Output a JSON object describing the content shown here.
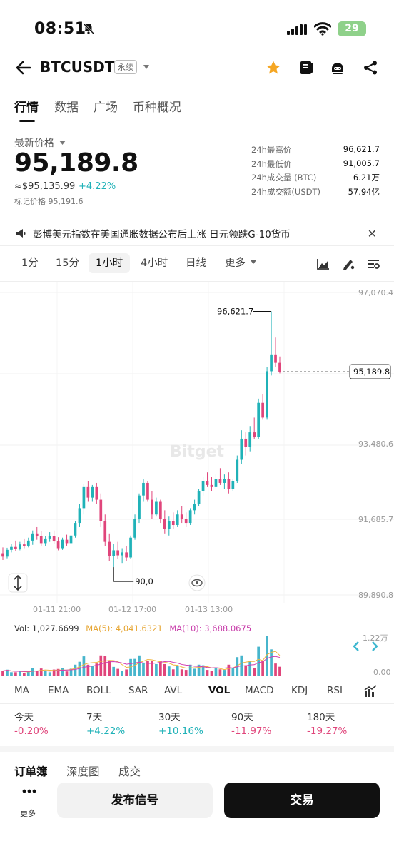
{
  "status_bar": {
    "time": "08:51",
    "battery": "29"
  },
  "header": {
    "symbol": "BTCUSDT",
    "badge": "永续"
  },
  "tabs": [
    "行情",
    "数据",
    "广场",
    "币种概况"
  ],
  "price": {
    "label": "最新价格",
    "last": "95,189.8",
    "usd": "≈$95,135.99",
    "change": "+4.22%",
    "mark": "标记价格 95,191.6"
  },
  "stats": [
    {
      "label": "24h最高价",
      "value": "96,621.7"
    },
    {
      "label": "24h最低价",
      "value": "91,005.7"
    },
    {
      "label": "24h成交量 (BTC)",
      "value": "6.21万"
    },
    {
      "label": "24h成交额(USDT)",
      "value": "57.94亿"
    }
  ],
  "news": {
    "text": "彭博美元指数在美国通胀数据公布后上涨 日元领跌G-10货币"
  },
  "timeframes": [
    "1分",
    "15分",
    "1小时",
    "4小时",
    "日线",
    "更多"
  ],
  "active_timeframe": "1小时",
  "chart_data": {
    "type": "candlestick",
    "y_ticks": [
      "97,070.4",
      "93,480.6",
      "91,685.7",
      "89,890.8"
    ],
    "x_ticks": [
      "01-11 21:00",
      "01-12 17:00",
      "01-13 13:00"
    ],
    "ylim": [
      89890.8,
      97070.4
    ],
    "current_price_tag": "95,189.8",
    "high_label": "96,621.7",
    "low_label": "90,0",
    "watermark": "Bitget",
    "candles": [
      {
        "o": 90880,
        "h": 91020,
        "l": 90720,
        "c": 90800
      },
      {
        "o": 90800,
        "h": 91010,
        "l": 90760,
        "c": 90960
      },
      {
        "o": 90960,
        "h": 91110,
        "l": 90900,
        "c": 91030
      },
      {
        "o": 91030,
        "h": 91180,
        "l": 90930,
        "c": 90980
      },
      {
        "o": 90980,
        "h": 91150,
        "l": 90950,
        "c": 91090
      },
      {
        "o": 91090,
        "h": 91230,
        "l": 91000,
        "c": 91060
      },
      {
        "o": 91060,
        "h": 91250,
        "l": 91020,
        "c": 91180
      },
      {
        "o": 91180,
        "h": 91420,
        "l": 91080,
        "c": 91350
      },
      {
        "o": 91350,
        "h": 91500,
        "l": 91200,
        "c": 91280
      },
      {
        "o": 91280,
        "h": 91400,
        "l": 91050,
        "c": 91120
      },
      {
        "o": 91120,
        "h": 91290,
        "l": 91050,
        "c": 91230
      },
      {
        "o": 91230,
        "h": 91380,
        "l": 91150,
        "c": 91290
      },
      {
        "o": 91290,
        "h": 91420,
        "l": 91100,
        "c": 91160
      },
      {
        "o": 91160,
        "h": 91260,
        "l": 90950,
        "c": 91000
      },
      {
        "o": 91000,
        "h": 91250,
        "l": 90960,
        "c": 91200
      },
      {
        "o": 91200,
        "h": 91320,
        "l": 91060,
        "c": 91120
      },
      {
        "o": 91120,
        "h": 91380,
        "l": 91090,
        "c": 91300
      },
      {
        "o": 91300,
        "h": 91650,
        "l": 91250,
        "c": 91600
      },
      {
        "o": 91600,
        "h": 92050,
        "l": 91500,
        "c": 91950
      },
      {
        "o": 91950,
        "h": 92520,
        "l": 91800,
        "c": 92450
      },
      {
        "o": 92450,
        "h": 92600,
        "l": 92100,
        "c": 92200
      },
      {
        "o": 92200,
        "h": 92500,
        "l": 92100,
        "c": 92450
      },
      {
        "o": 92450,
        "h": 92550,
        "l": 92050,
        "c": 92150
      },
      {
        "o": 92150,
        "h": 92300,
        "l": 91500,
        "c": 91650
      },
      {
        "o": 91650,
        "h": 91800,
        "l": 91050,
        "c": 91150
      },
      {
        "o": 91150,
        "h": 91350,
        "l": 90700,
        "c": 90820
      },
      {
        "o": 90820,
        "h": 91100,
        "l": 90550,
        "c": 90950
      },
      {
        "o": 90950,
        "h": 91150,
        "l": 90750,
        "c": 90830
      },
      {
        "o": 90830,
        "h": 91000,
        "l": 90650,
        "c": 90900
      },
      {
        "o": 90900,
        "h": 91050,
        "l": 90700,
        "c": 90780
      },
      {
        "o": 90780,
        "h": 91300,
        "l": 90750,
        "c": 91250
      },
      {
        "o": 91250,
        "h": 91800,
        "l": 91200,
        "c": 91700
      },
      {
        "o": 91700,
        "h": 92300,
        "l": 91600,
        "c": 92250
      },
      {
        "o": 92250,
        "h": 92650,
        "l": 92100,
        "c": 92550
      },
      {
        "o": 92550,
        "h": 92600,
        "l": 92100,
        "c": 92150
      },
      {
        "o": 92150,
        "h": 92350,
        "l": 91700,
        "c": 91800
      },
      {
        "o": 91800,
        "h": 92200,
        "l": 91750,
        "c": 92100
      },
      {
        "o": 92100,
        "h": 92150,
        "l": 91600,
        "c": 91700
      },
      {
        "o": 91700,
        "h": 91900,
        "l": 91350,
        "c": 91450
      },
      {
        "o": 91450,
        "h": 91750,
        "l": 91300,
        "c": 91650
      },
      {
        "o": 91650,
        "h": 91850,
        "l": 91450,
        "c": 91550
      },
      {
        "o": 91550,
        "h": 91900,
        "l": 91500,
        "c": 91800
      },
      {
        "o": 91800,
        "h": 92000,
        "l": 91600,
        "c": 91700
      },
      {
        "o": 91700,
        "h": 91850,
        "l": 91500,
        "c": 91600
      },
      {
        "o": 91600,
        "h": 91950,
        "l": 91550,
        "c": 91900
      },
      {
        "o": 91900,
        "h": 92150,
        "l": 91800,
        "c": 92050
      },
      {
        "o": 92050,
        "h": 92400,
        "l": 92000,
        "c": 92350
      },
      {
        "o": 92350,
        "h": 92700,
        "l": 92250,
        "c": 92600
      },
      {
        "o": 92600,
        "h": 92800,
        "l": 92450,
        "c": 92500
      },
      {
        "o": 92500,
        "h": 92700,
        "l": 92350,
        "c": 92450
      },
      {
        "o": 92450,
        "h": 92750,
        "l": 92400,
        "c": 92650
      },
      {
        "o": 92650,
        "h": 92900,
        "l": 92500,
        "c": 92550
      },
      {
        "o": 92550,
        "h": 92750,
        "l": 92400,
        "c": 92650
      },
      {
        "o": 92650,
        "h": 92800,
        "l": 92300,
        "c": 92400
      },
      {
        "o": 92400,
        "h": 92650,
        "l": 92350,
        "c": 92600
      },
      {
        "o": 92600,
        "h": 93200,
        "l": 92550,
        "c": 93100
      },
      {
        "o": 93100,
        "h": 93800,
        "l": 93000,
        "c": 93600
      },
      {
        "o": 93600,
        "h": 93750,
        "l": 93200,
        "c": 93400
      },
      {
        "o": 93400,
        "h": 93900,
        "l": 93300,
        "c": 93750
      },
      {
        "o": 93750,
        "h": 94100,
        "l": 93600,
        "c": 93650
      },
      {
        "o": 93650,
        "h": 94550,
        "l": 93600,
        "c": 94450
      },
      {
        "o": 94450,
        "h": 94650,
        "l": 94050,
        "c": 94100
      },
      {
        "o": 94100,
        "h": 95300,
        "l": 94050,
        "c": 95200
      },
      {
        "o": 95200,
        "h": 96621.7,
        "l": 95100,
        "c": 95600
      },
      {
        "o": 95600,
        "h": 96000,
        "l": 95300,
        "c": 95400
      },
      {
        "o": 95400,
        "h": 95550,
        "l": 95150,
        "c": 95189.8
      }
    ]
  },
  "volume": {
    "vol_label": "Vol: 1,027.6699",
    "ma5_label": "MA(5): 4,041.6321",
    "ma10_label": "MA(10): 3,688.0675",
    "y_top": "1.22万",
    "y_bottom": "0.00",
    "colors": {
      "up": "#47b5cc",
      "down": "#e0457b",
      "ma5": "#f0b43c",
      "ma10": "#d23cb4"
    }
  },
  "indicators": [
    "MA",
    "EMA",
    "BOLL",
    "SAR",
    "AVL",
    "VOL",
    "MACD",
    "KDJ",
    "RSI"
  ],
  "active_indicator": "VOL",
  "performance": [
    {
      "label": "今天",
      "value": "-0.20%",
      "dir": "down"
    },
    {
      "label": "7天",
      "value": "+4.22%",
      "dir": "up"
    },
    {
      "label": "30天",
      "value": "+10.16%",
      "dir": "up"
    },
    {
      "label": "90天",
      "value": "-11.97%",
      "dir": "down"
    },
    {
      "label": "180天",
      "value": "-19.27%",
      "dir": "down"
    }
  ],
  "orderbook_tabs": [
    "订单簿",
    "深度图",
    "成交"
  ],
  "bottom": {
    "more": "更多",
    "signal_btn": "发布信号",
    "trade_btn": "交易"
  },
  "colors": {
    "up": "#20b2b8",
    "down": "#e0457b",
    "star": "#f5a623"
  }
}
